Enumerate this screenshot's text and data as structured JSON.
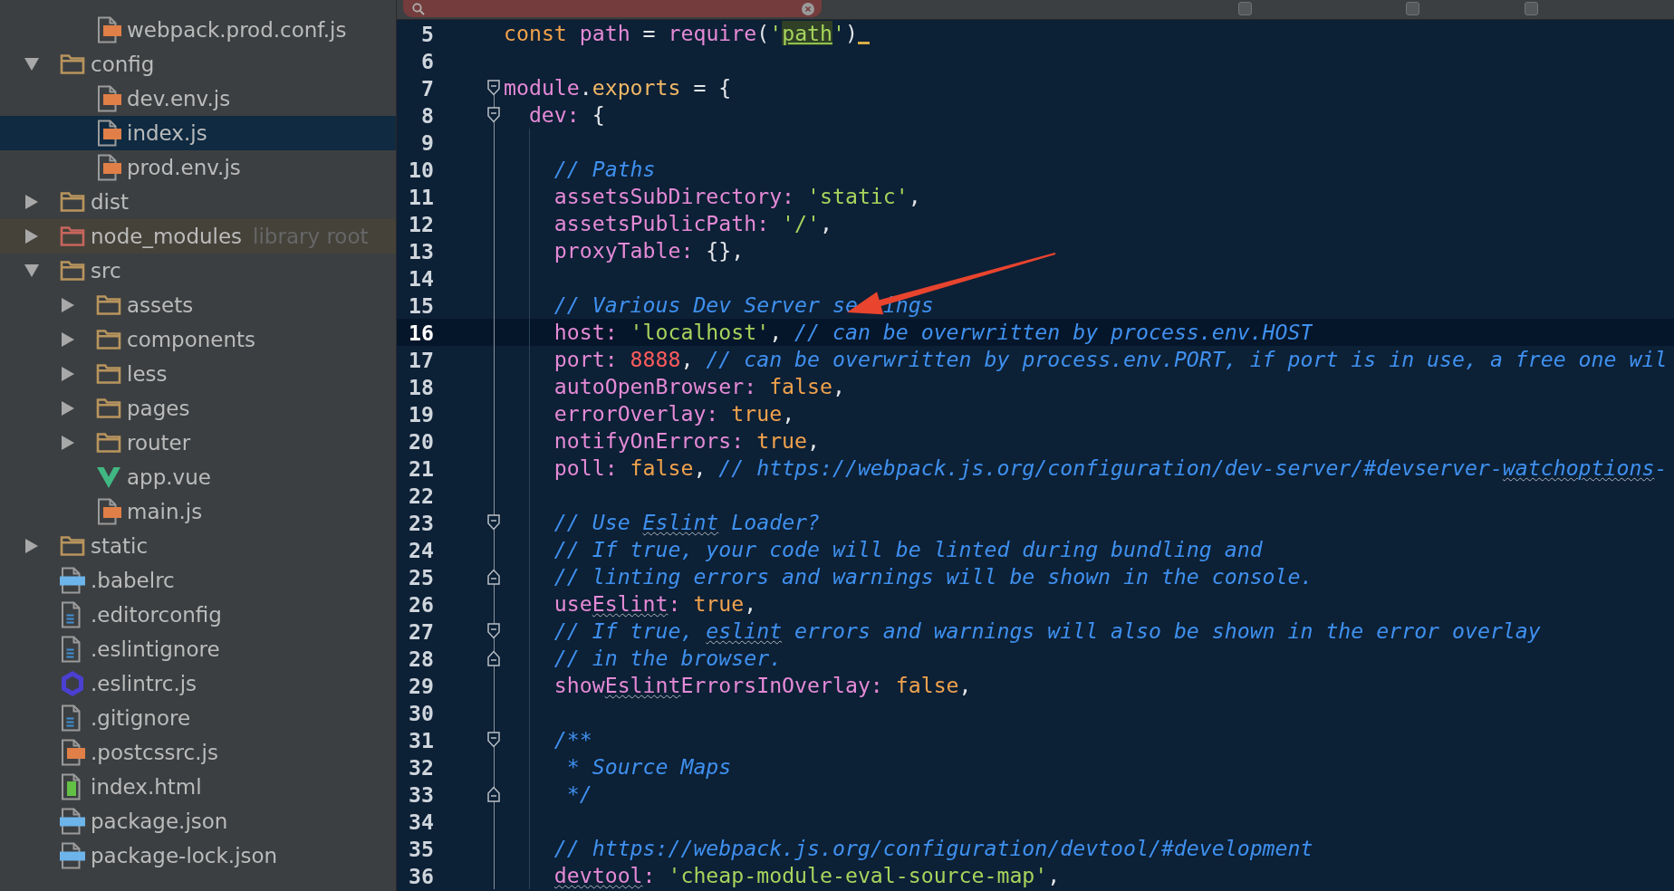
{
  "find_bar": {
    "no_match": true,
    "options": [
      {
        "checked": false
      },
      {
        "checked": false
      },
      {
        "checked": false
      }
    ]
  },
  "project_tree": [
    {
      "children": [
        {
          "label": "webpack.prod.conf.js",
          "kind": "js",
          "selected": false
        }
      ]
    },
    {
      "label": "config",
      "kind": "folder",
      "expanded": true,
      "selected": false,
      "children": [
        {
          "label": "dev.env.js",
          "kind": "js",
          "selected": false
        },
        {
          "label": "index.js",
          "kind": "js",
          "selected": true
        },
        {
          "label": "prod.env.js",
          "kind": "js",
          "selected": false
        }
      ]
    },
    {
      "label": "dist",
      "kind": "folder",
      "expanded": false,
      "selected": false
    },
    {
      "label": "node_modules",
      "kind": "library",
      "hint": "library root",
      "expanded": false,
      "selected": false
    },
    {
      "label": "src",
      "kind": "folder",
      "expanded": true,
      "selected": false,
      "children": [
        {
          "label": "assets",
          "kind": "folder",
          "expanded": false,
          "selected": false
        },
        {
          "label": "components",
          "kind": "folder",
          "expanded": false,
          "selected": false
        },
        {
          "label": "less",
          "kind": "folder",
          "expanded": false,
          "selected": false
        },
        {
          "label": "pages",
          "kind": "folder",
          "expanded": false,
          "selected": false
        },
        {
          "label": "router",
          "kind": "folder",
          "expanded": false,
          "selected": false
        },
        {
          "label": "app.vue",
          "kind": "vue",
          "selected": false
        },
        {
          "label": "main.js",
          "kind": "js",
          "selected": false
        }
      ]
    },
    {
      "label": "static",
      "kind": "folder",
      "expanded": false,
      "selected": false
    },
    {
      "label": ".babelrc",
      "kind": "json",
      "selected": false
    },
    {
      "label": ".editorconfig",
      "kind": "text",
      "selected": false
    },
    {
      "label": ".eslintignore",
      "kind": "text",
      "selected": false
    },
    {
      "label": ".eslintrc.js",
      "kind": "eslint",
      "selected": false
    },
    {
      "label": ".gitignore",
      "kind": "text",
      "selected": false
    },
    {
      "label": ".postcssrc.js",
      "kind": "js",
      "selected": false
    },
    {
      "label": "index.html",
      "kind": "html",
      "selected": false
    },
    {
      "label": "package.json",
      "kind": "json",
      "selected": false
    },
    {
      "label": "package-lock.json",
      "kind": "json",
      "selected": false
    }
  ],
  "editor": {
    "lines": [
      {
        "number": "5",
        "current": false,
        "cursor": true,
        "tokens": [
          {
            "kind": "keyword",
            "text": "const"
          },
          {
            "kind": "name",
            "text": " path"
          },
          {
            "kind": "punct",
            "text": " = "
          },
          {
            "kind": "name",
            "text": "require"
          },
          {
            "kind": "punct",
            "text": "("
          },
          {
            "kind": "string",
            "text": "'"
          },
          {
            "kind": "string",
            "text": "path",
            "highlight": true
          },
          {
            "kind": "string",
            "text": "'"
          },
          {
            "kind": "punct",
            "text": ")"
          }
        ]
      },
      {
        "number": "6",
        "current": false,
        "cursor": false
      },
      {
        "number": "7",
        "current": false,
        "cursor": false,
        "fold": {
          "kind": "start"
        },
        "tokens": [
          {
            "kind": "name",
            "text": "module"
          },
          {
            "kind": "punct",
            "text": "."
          },
          {
            "kind": "member",
            "text": "exports"
          },
          {
            "kind": "punct",
            "text": " = {"
          }
        ]
      },
      {
        "number": "8",
        "current": false,
        "cursor": false,
        "fold": {
          "kind": "start"
        },
        "tokens": [
          {
            "kind": "property",
            "text": "  dev:"
          },
          {
            "kind": "punct",
            "text": " {"
          }
        ]
      },
      {
        "number": "9",
        "current": false,
        "cursor": false
      },
      {
        "number": "10",
        "current": false,
        "cursor": false,
        "tokens": [
          {
            "kind": "comment",
            "text": "    // Paths"
          }
        ]
      },
      {
        "number": "11",
        "current": false,
        "cursor": false,
        "tokens": [
          {
            "kind": "property",
            "text": "    assetsSubDirectory:"
          },
          {
            "kind": "string",
            "text": " 'static'"
          },
          {
            "kind": "punct",
            "text": ","
          }
        ]
      },
      {
        "number": "12",
        "current": false,
        "cursor": false,
        "tokens": [
          {
            "kind": "property",
            "text": "    assetsPublicPath:"
          },
          {
            "kind": "string",
            "text": " '/'"
          },
          {
            "kind": "punct",
            "text": ","
          }
        ]
      },
      {
        "number": "13",
        "current": false,
        "cursor": false,
        "tokens": [
          {
            "kind": "property",
            "text": "    proxyTable:"
          },
          {
            "kind": "punct",
            "text": " {},"
          }
        ]
      },
      {
        "number": "14",
        "current": false,
        "cursor": false
      },
      {
        "number": "15",
        "current": false,
        "cursor": false,
        "tokens": [
          {
            "kind": "comment",
            "text": "    // Various Dev Server se"
          },
          {
            "kind": "comment",
            "text": "  ings"
          }
        ]
      },
      {
        "number": "16",
        "current": true,
        "cursor": false,
        "tokens": [
          {
            "kind": "property",
            "text": "    host:"
          },
          {
            "kind": "string",
            "text": " 'localhost'"
          },
          {
            "kind": "punct",
            "text": ", "
          },
          {
            "kind": "comment",
            "text": "// can be overwritten by process.env.HOST"
          }
        ]
      },
      {
        "number": "17",
        "current": false,
        "cursor": false,
        "tokens": [
          {
            "kind": "property",
            "text": "    port:"
          },
          {
            "kind": "number",
            "text": " 8888"
          },
          {
            "kind": "punct",
            "text": ", "
          },
          {
            "kind": "comment",
            "text": "// can be overwritten by process.env.PORT, if port is in use, a free one wil"
          }
        ]
      },
      {
        "number": "18",
        "current": false,
        "cursor": false,
        "tokens": [
          {
            "kind": "property",
            "text": "    autoOpenBrowser:"
          },
          {
            "kind": "literal",
            "text": " false"
          },
          {
            "kind": "punct",
            "text": ","
          }
        ]
      },
      {
        "number": "19",
        "current": false,
        "cursor": false,
        "tokens": [
          {
            "kind": "property",
            "text": "    errorOverlay:"
          },
          {
            "kind": "literal",
            "text": " true"
          },
          {
            "kind": "punct",
            "text": ","
          }
        ]
      },
      {
        "number": "20",
        "current": false,
        "cursor": false,
        "tokens": [
          {
            "kind": "property",
            "text": "    notifyOnErrors:"
          },
          {
            "kind": "literal",
            "text": " true"
          },
          {
            "kind": "punct",
            "text": ","
          }
        ]
      },
      {
        "number": "21",
        "current": false,
        "cursor": false,
        "tokens": [
          {
            "kind": "property",
            "text": "    poll:"
          },
          {
            "kind": "literal",
            "text": " false"
          },
          {
            "kind": "punct",
            "text": ", "
          },
          {
            "kind": "comment",
            "text": "// https://webpack.js.org/configuration/dev-server/#devserver-"
          },
          {
            "kind": "comment",
            "text": "watchoptions",
            "typo": true
          },
          {
            "kind": "comment",
            "text": "-"
          }
        ]
      },
      {
        "number": "22",
        "current": false,
        "cursor": false
      },
      {
        "number": "23",
        "current": false,
        "cursor": false,
        "fold": {
          "kind": "start"
        },
        "tokens": [
          {
            "kind": "comment",
            "text": "    // Use "
          },
          {
            "kind": "comment",
            "text": "Eslint",
            "typo": true
          },
          {
            "kind": "comment",
            "text": " Loader?"
          }
        ]
      },
      {
        "number": "24",
        "current": false,
        "cursor": false,
        "tokens": [
          {
            "kind": "comment",
            "text": "    // If true, your code will be linted during bundling and"
          }
        ]
      },
      {
        "number": "25",
        "current": false,
        "cursor": false,
        "fold": {
          "kind": "end"
        },
        "tokens": [
          {
            "kind": "comment",
            "text": "    // linting errors and warnings will be shown in the console."
          }
        ]
      },
      {
        "number": "26",
        "current": false,
        "cursor": false,
        "tokens": [
          {
            "kind": "property",
            "text": "    use"
          },
          {
            "kind": "property",
            "text": "Eslint",
            "typo": true
          },
          {
            "kind": "property",
            "text": ":"
          },
          {
            "kind": "literal",
            "text": " true"
          },
          {
            "kind": "punct",
            "text": ","
          }
        ]
      },
      {
        "number": "27",
        "current": false,
        "cursor": false,
        "fold": {
          "kind": "start"
        },
        "tokens": [
          {
            "kind": "comment",
            "text": "    // If true, "
          },
          {
            "kind": "comment",
            "text": "eslint",
            "typo": true
          },
          {
            "kind": "comment",
            "text": " errors and warnings will also be shown in the error overlay"
          }
        ]
      },
      {
        "number": "28",
        "current": false,
        "cursor": false,
        "fold": {
          "kind": "end"
        },
        "tokens": [
          {
            "kind": "comment",
            "text": "    // in the browser."
          }
        ]
      },
      {
        "number": "29",
        "current": false,
        "cursor": false,
        "tokens": [
          {
            "kind": "property",
            "text": "    show"
          },
          {
            "kind": "property",
            "text": "Eslint",
            "typo": true
          },
          {
            "kind": "property",
            "text": "ErrorsInOverlay:"
          },
          {
            "kind": "literal",
            "text": " false"
          },
          {
            "kind": "punct",
            "text": ","
          }
        ]
      },
      {
        "number": "30",
        "current": false,
        "cursor": false
      },
      {
        "number": "31",
        "current": false,
        "cursor": false,
        "fold": {
          "kind": "start"
        },
        "tokens": [
          {
            "kind": "comment",
            "text": "    /**"
          }
        ]
      },
      {
        "number": "32",
        "current": false,
        "cursor": false,
        "tokens": [
          {
            "kind": "comment",
            "text": "     * Source Maps"
          }
        ]
      },
      {
        "number": "33",
        "current": false,
        "cursor": false,
        "fold": {
          "kind": "end"
        },
        "tokens": [
          {
            "kind": "comment",
            "text": "     */"
          }
        ]
      },
      {
        "number": "34",
        "current": false,
        "cursor": false
      },
      {
        "number": "35",
        "current": false,
        "cursor": false,
        "tokens": [
          {
            "kind": "comment",
            "text": "    // https://webpack.js.org/configuration/devtool/#development"
          }
        ]
      },
      {
        "number": "36",
        "current": false,
        "cursor": false,
        "tokens": [
          {
            "kind": "property",
            "text": "    devtool",
            "typo": true
          },
          {
            "kind": "property",
            "text": ":"
          },
          {
            "kind": "string",
            "text": " 'cheap-module-eval-source-map'"
          },
          {
            "kind": "punct",
            "text": ","
          }
        ]
      }
    ]
  },
  "annotations": [
    {
      "kind": "arrow"
    }
  ]
}
